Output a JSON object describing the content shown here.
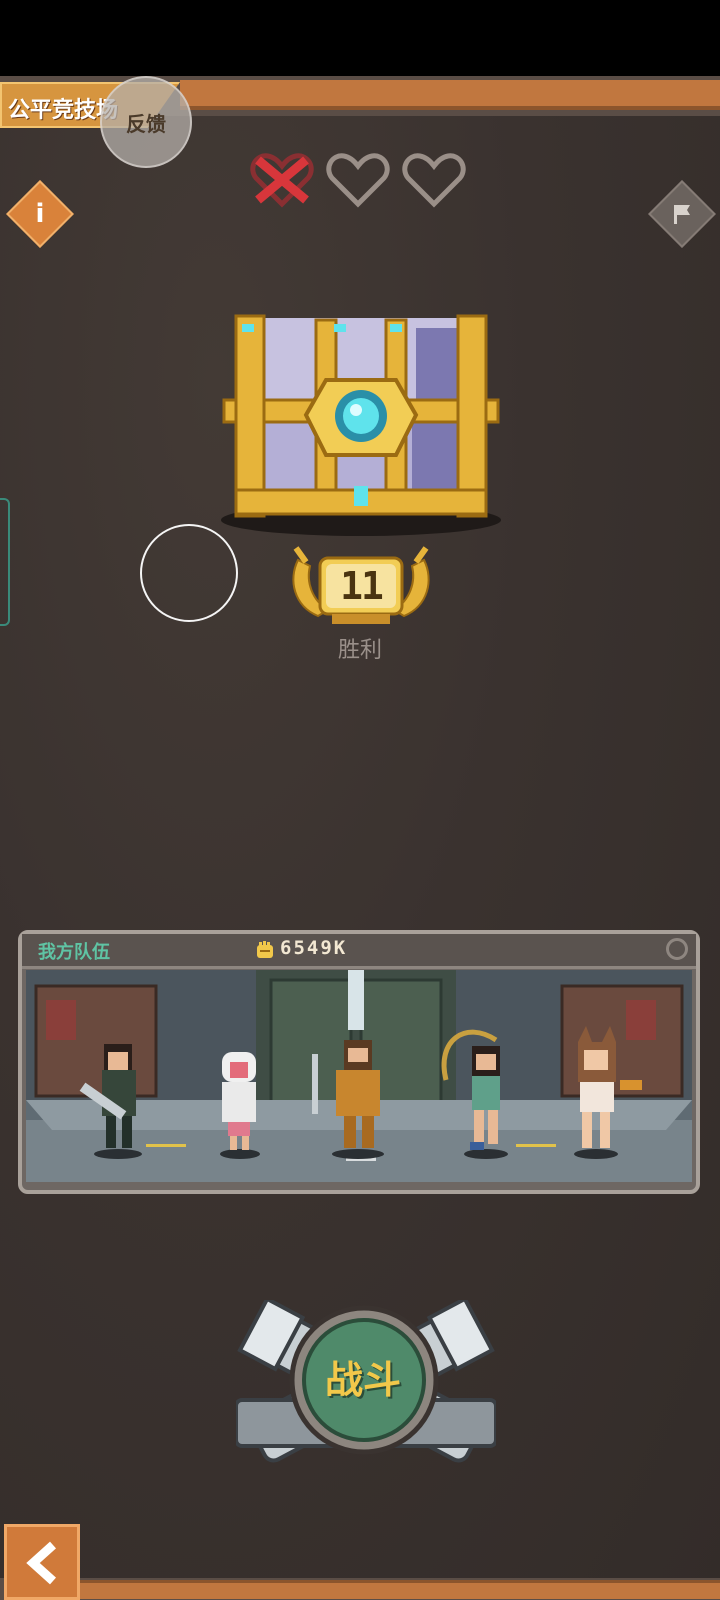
{
  "header": {
    "mode_title": "公平竞技场",
    "feedback_label": "反馈"
  },
  "lives": {
    "total": 3,
    "lost": 1,
    "icons": [
      "heart-lost-icon",
      "heart-empty-icon",
      "heart-empty-icon"
    ]
  },
  "buttons": {
    "info_label": "i",
    "flag_icon": "flag-icon",
    "back_icon": "chevron-left-icon"
  },
  "reward": {
    "wins": "11",
    "wins_label": "胜利",
    "chest_icon": "golden-chest-icon"
  },
  "team": {
    "title": "我方队伍",
    "power": "6549K",
    "power_icon": "fist-icon",
    "heroes": [
      "hero-dark-hair-swordsman",
      "hero-white-hood",
      "hero-bearded-armored",
      "hero-whip-girl",
      "hero-cat-ear-girl"
    ]
  },
  "action": {
    "fight_label": "战斗"
  },
  "colors": {
    "accent_orange": "#d9823a",
    "gold": "#e6b43a",
    "team_title": "#5fc4a4",
    "fight_green": "#4f8a6a"
  }
}
